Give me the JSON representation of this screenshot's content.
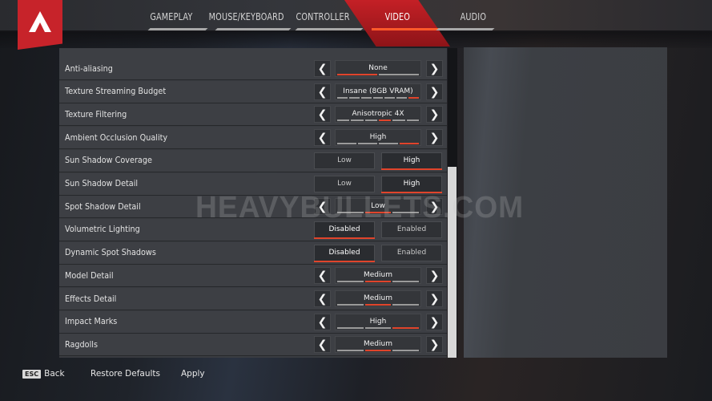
{
  "nav": {
    "logo": "apex-legends-logo",
    "tabs": [
      {
        "label": "GAMEPLAY",
        "active": false
      },
      {
        "label": "MOUSE/KEYBOARD",
        "active": false
      },
      {
        "label": "CONTROLLER",
        "active": false
      },
      {
        "label": "VIDEO",
        "active": true
      },
      {
        "label": "AUDIO",
        "active": false
      }
    ]
  },
  "settings": {
    "rows": [
      {
        "label": "Anti-aliasing",
        "type": "stepper",
        "value": "None",
        "segments": 2,
        "selected_index": 0
      },
      {
        "label": "Texture Streaming Budget",
        "type": "stepper",
        "value": "Insane (8GB VRAM)",
        "segments": 7,
        "selected_index": 6
      },
      {
        "label": "Texture Filtering",
        "type": "stepper",
        "value": "Anisotropic 4X",
        "segments": 6,
        "selected_index": 3
      },
      {
        "label": "Ambient Occlusion Quality",
        "type": "stepper",
        "value": "High",
        "segments": 4,
        "selected_index": 3
      },
      {
        "label": "Sun Shadow Coverage",
        "type": "toggle",
        "options": [
          "Low",
          "High"
        ],
        "selected_index": 1
      },
      {
        "label": "Sun Shadow Detail",
        "type": "toggle",
        "options": [
          "Low",
          "High"
        ],
        "selected_index": 1
      },
      {
        "label": "Spot Shadow Detail",
        "type": "stepper",
        "value": "Low",
        "segments": 3,
        "selected_index": 1
      },
      {
        "label": "Volumetric Lighting",
        "type": "toggle",
        "options": [
          "Disabled",
          "Enabled"
        ],
        "selected_index": 0
      },
      {
        "label": "Dynamic Spot Shadows",
        "type": "toggle",
        "options": [
          "Disabled",
          "Enabled"
        ],
        "selected_index": 0
      },
      {
        "label": "Model Detail",
        "type": "stepper",
        "value": "Medium",
        "segments": 3,
        "selected_index": 1
      },
      {
        "label": "Effects Detail",
        "type": "stepper",
        "value": "Medium",
        "segments": 3,
        "selected_index": 1
      },
      {
        "label": "Impact Marks",
        "type": "stepper",
        "value": "High",
        "segments": 3,
        "selected_index": 2
      },
      {
        "label": "Ragdolls",
        "type": "stepper",
        "value": "Medium",
        "segments": 3,
        "selected_index": 1
      }
    ]
  },
  "watermark": "HEAVYBULLETS.COM",
  "footer": {
    "esc_key": "ESC",
    "back_label": "Back",
    "restore_label": "Restore Defaults",
    "apply_label": "Apply"
  },
  "colors": {
    "accent": "#e0442b",
    "tab_active": "#b81d22",
    "logo_bg": "#c7232a"
  }
}
